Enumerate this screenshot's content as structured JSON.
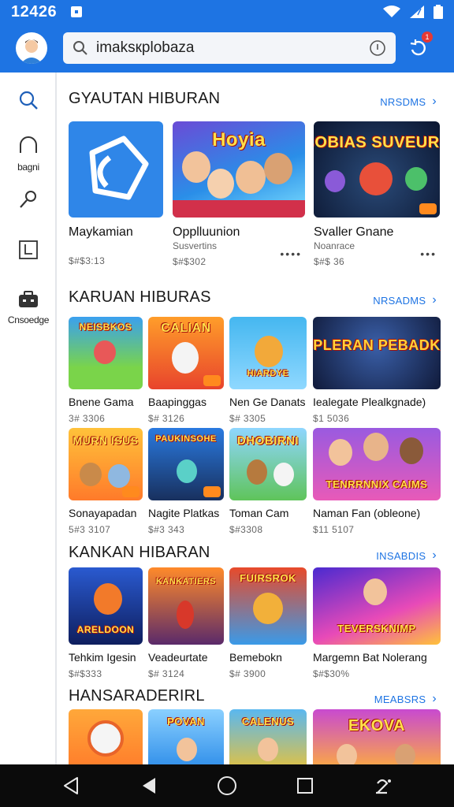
{
  "status": {
    "time": "12426"
  },
  "search": {
    "query": "imaksкplobaza"
  },
  "notifications": {
    "count": "1"
  },
  "sidebar": {
    "items": [
      {
        "icon": "search-icon",
        "label": ""
      },
      {
        "icon": "headphones-icon",
        "label": "bagni"
      },
      {
        "icon": "brush-icon",
        "label": ""
      },
      {
        "icon": "bookmark-icon",
        "label": ""
      },
      {
        "icon": "briefcase-icon",
        "label": "Cnsoedge"
      }
    ]
  },
  "sections": [
    {
      "title": "GYAUTAN HIBURAN",
      "more": "NRSDMS",
      "cards": [
        {
          "title": "Maykamian",
          "subtitle": "",
          "meta": "$#$3:13",
          "art": ""
        },
        {
          "title": "Opplluunion",
          "subtitle": "Susvertins",
          "meta": "$#$302",
          "art": "Hoyia"
        },
        {
          "title": "Svaller Gnane",
          "subtitle": "Noanrace",
          "meta": "$#$ 36",
          "art": "BOBIAS SUVEURS"
        }
      ]
    },
    {
      "title": "KARUAN HIBURAS",
      "more": "NRSADMS",
      "rows": [
        [
          {
            "title": "Bnene Gama",
            "meta": "3# 3306",
            "art": "NEISBKOS"
          },
          {
            "title": "Baapinggas",
            "meta": "$# 3126",
            "art": "CALIAN"
          },
          {
            "title": "Nen Ge Danats",
            "meta": "$# 3305",
            "art": "HIARDYE"
          },
          {
            "title": "Iealegate Plealkgnade)",
            "meta": "$1 5036",
            "art": "PLERAN PEBADK"
          }
        ],
        [
          {
            "title": "Sonayapadan",
            "meta": "5#3 3107",
            "art": "MURN ISUS"
          },
          {
            "title": "Nagite Platkas",
            "meta": "$#3 343",
            "art": "PAUKINSOHE"
          },
          {
            "title": "Toman Cam",
            "meta": "$#3308",
            "art": "DHOBIRNI"
          },
          {
            "title": "Naman Fan (obleone)",
            "meta": "$11 5107",
            "art": "TENRRNNIX CAIMS"
          }
        ]
      ]
    },
    {
      "title": "KANKAN HIBARAN",
      "more": "INSABDIS",
      "cards": [
        {
          "title": "Tehkim Igesin",
          "meta": "$#$333",
          "art": "ARELDOON"
        },
        {
          "title": "Veadeurtate",
          "meta": "$# 3124",
          "art": "KANKATIERS"
        },
        {
          "title": "Bemebokn",
          "meta": "$# 3900",
          "art": "FUIRSROK"
        },
        {
          "title": "Margemn Bat Nolerang",
          "meta": "$#$30%",
          "art": "TEVERSKNIMP"
        }
      ]
    },
    {
      "title": "HANSARADERIRL",
      "more": "MEABSRS",
      "cards": [
        {
          "art": ""
        },
        {
          "art": "POVAN"
        },
        {
          "art": "CALENUS"
        },
        {
          "art": "EKOVA"
        }
      ]
    }
  ],
  "colors": {
    "accent": "#1e74e3",
    "navbar": "#0b0b0b",
    "badge": "#e53935"
  }
}
